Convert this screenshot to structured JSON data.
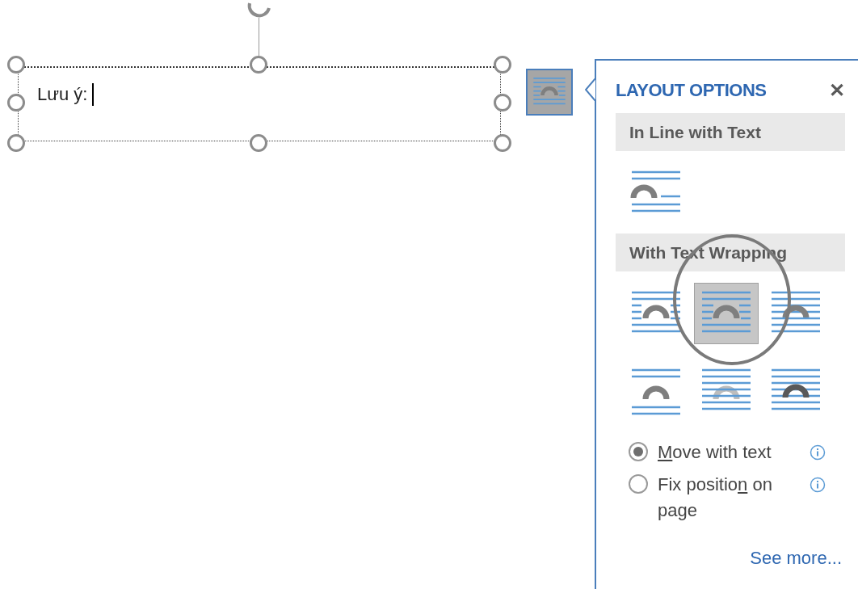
{
  "text_box": {
    "text": "Lưu ý:",
    "cursor": true
  },
  "panel": {
    "title": "LAYOUT OPTIONS",
    "close": "✕",
    "sections": [
      {
        "heading": "In Line with Text",
        "options": [
          {
            "kind": "inline",
            "selected": false
          }
        ]
      },
      {
        "heading": "With Text Wrapping",
        "options": [
          {
            "kind": "square",
            "selected": false
          },
          {
            "kind": "tight",
            "selected": true
          },
          {
            "kind": "through",
            "selected": false
          },
          {
            "kind": "top_bottom",
            "selected": false
          },
          {
            "kind": "behind",
            "selected": false
          },
          {
            "kind": "in_front",
            "selected": false
          }
        ]
      }
    ],
    "radios": [
      {
        "parts": [
          {
            "text": "M",
            "underline": true
          },
          {
            "text": "ove with text",
            "underline": false
          }
        ],
        "selected": true
      },
      {
        "parts": [
          {
            "text": "Fix positio",
            "underline": false
          },
          {
            "text": "n",
            "underline": true
          },
          {
            "text": " on page",
            "underline": false
          }
        ],
        "selected": false
      }
    ],
    "link": "See more..."
  }
}
